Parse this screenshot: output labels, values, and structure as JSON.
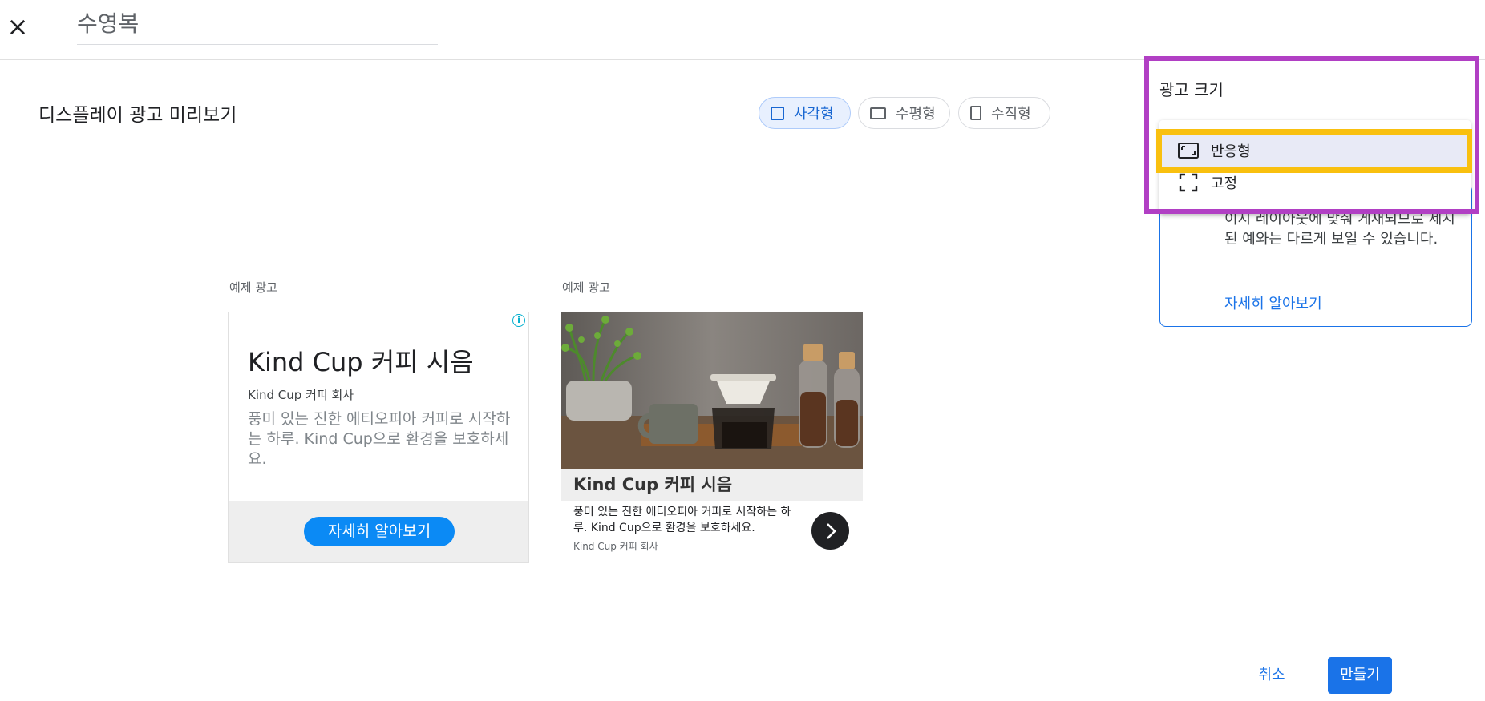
{
  "header": {
    "campaign_name": "수영복"
  },
  "preview": {
    "title": "디스플레이 광고 미리보기",
    "shape_toggles": [
      {
        "label": "사각형",
        "selected": true
      },
      {
        "label": "수평형",
        "selected": false
      },
      {
        "label": "수직형",
        "selected": false
      }
    ],
    "ad1": {
      "label": "예제 광고",
      "headline": "Kind Cup 커피 시음",
      "business": "Kind Cup 커피 회사",
      "description": "풍미 있는 진한 에티오피아 커피로 시작하는 하루. Kind Cup으로 환경을 보호하세요.",
      "cta": "자세히 알아보기"
    },
    "ad2": {
      "label": "예제 광고",
      "headline": "Kind Cup 커피 시음",
      "description": "풍미 있는 진한 에티오피아 커피로 시작하는 하루. Kind Cup으로 환경을 보호하세요.",
      "business": "Kind Cup 커피 회사"
    }
  },
  "panel": {
    "label": "광고 크기",
    "dropdown": {
      "options": [
        {
          "label": "반응형",
          "icon": "responsive-size-icon",
          "selected": true
        },
        {
          "label": "고정",
          "icon": "fixed-size-icon",
          "selected": false
        }
      ]
    },
    "info_text": "이지 레이아웃에 맞춰 게재되므로 제시된 예와는 다르게 보일 수 있습니다.",
    "info_link": "자세히 알아보기"
  },
  "footer": {
    "cancel": "취소",
    "create": "만들기"
  },
  "colors": {
    "accent": "#1a73e8",
    "highlight_outer": "#b13fc4",
    "highlight_inner": "#f9c00f",
    "cta_blue": "#0b8af5"
  }
}
